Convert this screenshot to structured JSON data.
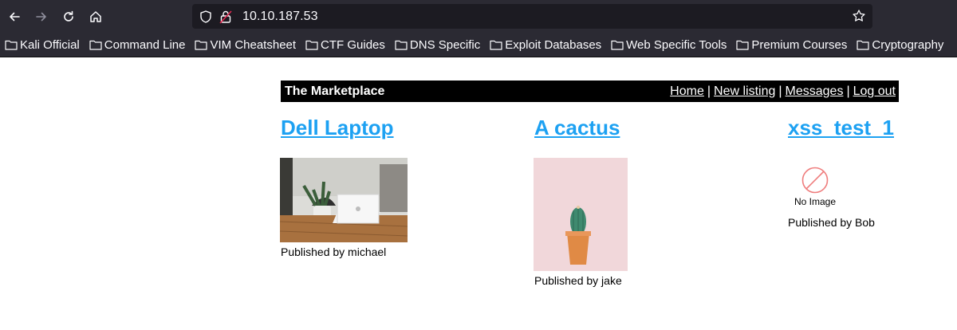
{
  "browser": {
    "url": "10.10.187.53",
    "bookmarks": [
      "Kali Official",
      "Command Line",
      "VIM Cheatsheet",
      "CTF Guides",
      "DNS Specific",
      "Exploit Databases",
      "Web Specific Tools",
      "Premium Courses",
      "Cryptography"
    ],
    "icons": {
      "back": "arrow-left-icon",
      "forward": "arrow-right-icon",
      "reload": "reload-icon",
      "home": "home-icon",
      "tracking": "shield-icon",
      "insecure": "insecure-lock-icon",
      "bookmark_star": "star-icon",
      "folder": "folder-icon"
    }
  },
  "site": {
    "title": "The Marketplace",
    "nav": [
      "Home",
      "New listing",
      "Messages",
      "Log out"
    ],
    "separator": "|"
  },
  "listings": [
    {
      "title": "Dell Laptop",
      "publisher": "Published by michael",
      "image": "laptop-photo"
    },
    {
      "title": "A cactus",
      "publisher": "Published by jake",
      "image": "cactus-photo"
    },
    {
      "title": "xss_test_1",
      "publisher": "Published by Bob",
      "image": "",
      "no_image_text": "No Image"
    }
  ],
  "colors": {
    "chrome_bg": "#2b2a33",
    "urlbar_bg": "#1c1b22",
    "link": "#1da1f2",
    "header_bg": "#000000"
  }
}
